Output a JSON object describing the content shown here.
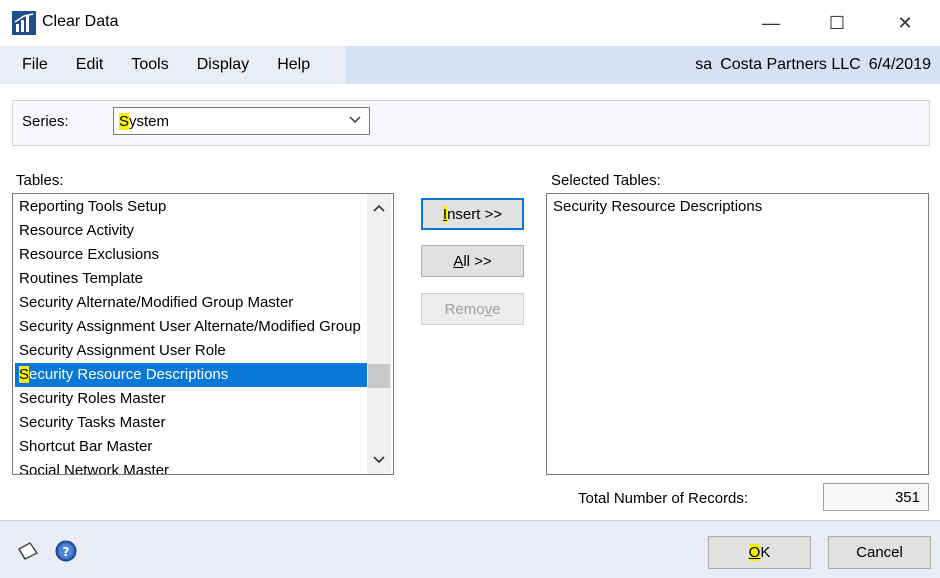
{
  "window": {
    "title": "Clear Data",
    "minimize_glyph": "—",
    "maximize_glyph": "☐",
    "close_glyph": "✕"
  },
  "menu": {
    "items": [
      "File",
      "Edit",
      "Tools",
      "Display",
      "Help"
    ]
  },
  "status": {
    "user": "sa",
    "company": "Costa Partners LLC",
    "date": "6/4/2019"
  },
  "series": {
    "label": "Series:",
    "value_first": "S",
    "value_rest": "ystem"
  },
  "tables": {
    "label": "Tables:",
    "items": [
      "Reporting Tools Setup",
      "Resource Activity",
      "Resource Exclusions",
      "Routines Template",
      "Security Alternate/Modified Group Master",
      "Security Assignment User Alternate/Modified Group",
      "Security Assignment User Role",
      "Security Resource Descriptions",
      "Security Roles Master",
      "Security Tasks Master",
      "Shortcut Bar Master",
      "Social Network Master"
    ],
    "selected_index": 7
  },
  "buttons": {
    "insert_key": "I",
    "insert_rest": "nsert >>",
    "all_key": "A",
    "all_rest": "ll >>",
    "remove_pre": "Remo",
    "remove_key": "v",
    "remove_post": "e",
    "ok_key": "O",
    "ok_rest": "K",
    "cancel": "Cancel"
  },
  "selected_tables": {
    "label": "Selected Tables:",
    "items": [
      "Security Resource Descriptions"
    ]
  },
  "records": {
    "label": "Total Number of Records:",
    "value": "351"
  },
  "icons": {
    "app": "dynamics-gp-icon",
    "note": "note-icon",
    "help": "help-icon"
  },
  "colors": {
    "accent": "#0a78d7",
    "highlight": "#f5f200",
    "menubar": "#d6e2f4"
  }
}
